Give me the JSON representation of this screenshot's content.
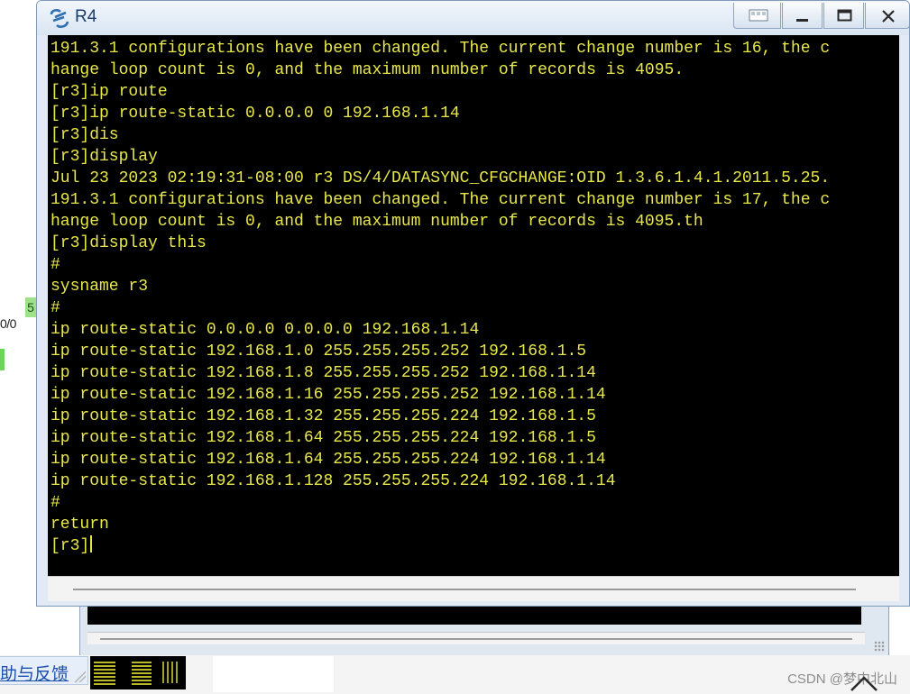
{
  "window": {
    "title": "R4"
  },
  "terminal": {
    "lines": [
      "191.3.1 configurations have been changed. The current change number is 16, the c",
      "hange loop count is 0, and the maximum number of records is 4095.",
      "[r3]ip route",
      "[r3]ip route-static 0.0.0.0 0 192.168.1.14",
      "[r3]dis",
      "[r3]display",
      "Jul 23 2023 02:19:31-08:00 r3 DS/4/DATASYNC_CFGCHANGE:OID 1.3.6.1.4.1.2011.5.25.",
      "191.3.1 configurations have been changed. The current change number is 17, the c",
      "hange loop count is 0, and the maximum number of records is 4095.th",
      "[r3]display this",
      "#",
      "sysname r3",
      "#",
      "ip route-static 0.0.0.0 0.0.0.0 192.168.1.14",
      "ip route-static 192.168.1.0 255.255.255.252 192.168.1.5",
      "ip route-static 192.168.1.8 255.255.255.252 192.168.1.14",
      "ip route-static 192.168.1.16 255.255.255.252 192.168.1.14",
      "ip route-static 192.168.1.32 255.255.255.224 192.168.1.5",
      "ip route-static 192.168.1.64 255.255.255.224 192.168.1.5",
      "ip route-static 192.168.1.64 255.255.255.224 192.168.1.14",
      "ip route-static 192.168.1.128 255.255.255.224 192.168.1.14",
      "#",
      "return",
      "[r3]"
    ],
    "text_color": "#e8e84a",
    "background": "#000000"
  },
  "background_app": {
    "badge": "5",
    "interface_text": "0/0",
    "help_link": "助与反馈",
    "watermark": "CSDN @梦中北山"
  },
  "icons": {
    "title": "router-app-icon",
    "restore": "restore-icon",
    "minimize": "minimize-icon",
    "maximize": "maximize-icon",
    "close": "close-icon",
    "scroll_up": "chevron-up-icon"
  }
}
